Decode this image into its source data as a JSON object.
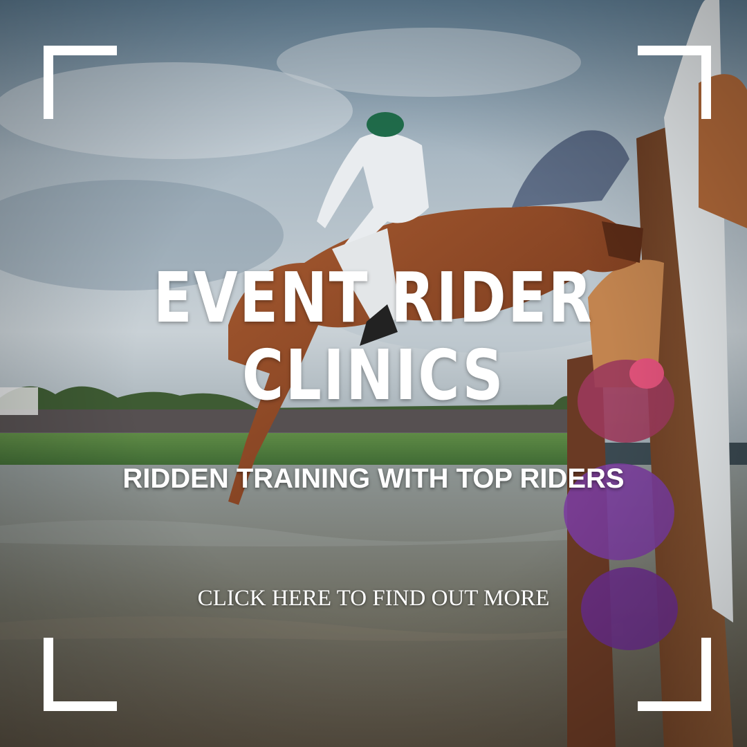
{
  "banner": {
    "title_line1": "EVENT RIDER",
    "title_line2": "CLINICS",
    "subtitle": "RIDDEN TRAINING WITH TOP RIDERS",
    "cta": "CLICK HERE TO FIND OUT MORE"
  },
  "colors": {
    "text": "#ffffff",
    "frame": "#ffffff",
    "sky": "#8fa4b3",
    "water": "#6b7068",
    "horse": "#8a4a2b",
    "grass": "#4f7a3e"
  },
  "icons": {
    "frame_corners": "corner-bracket-icon"
  }
}
